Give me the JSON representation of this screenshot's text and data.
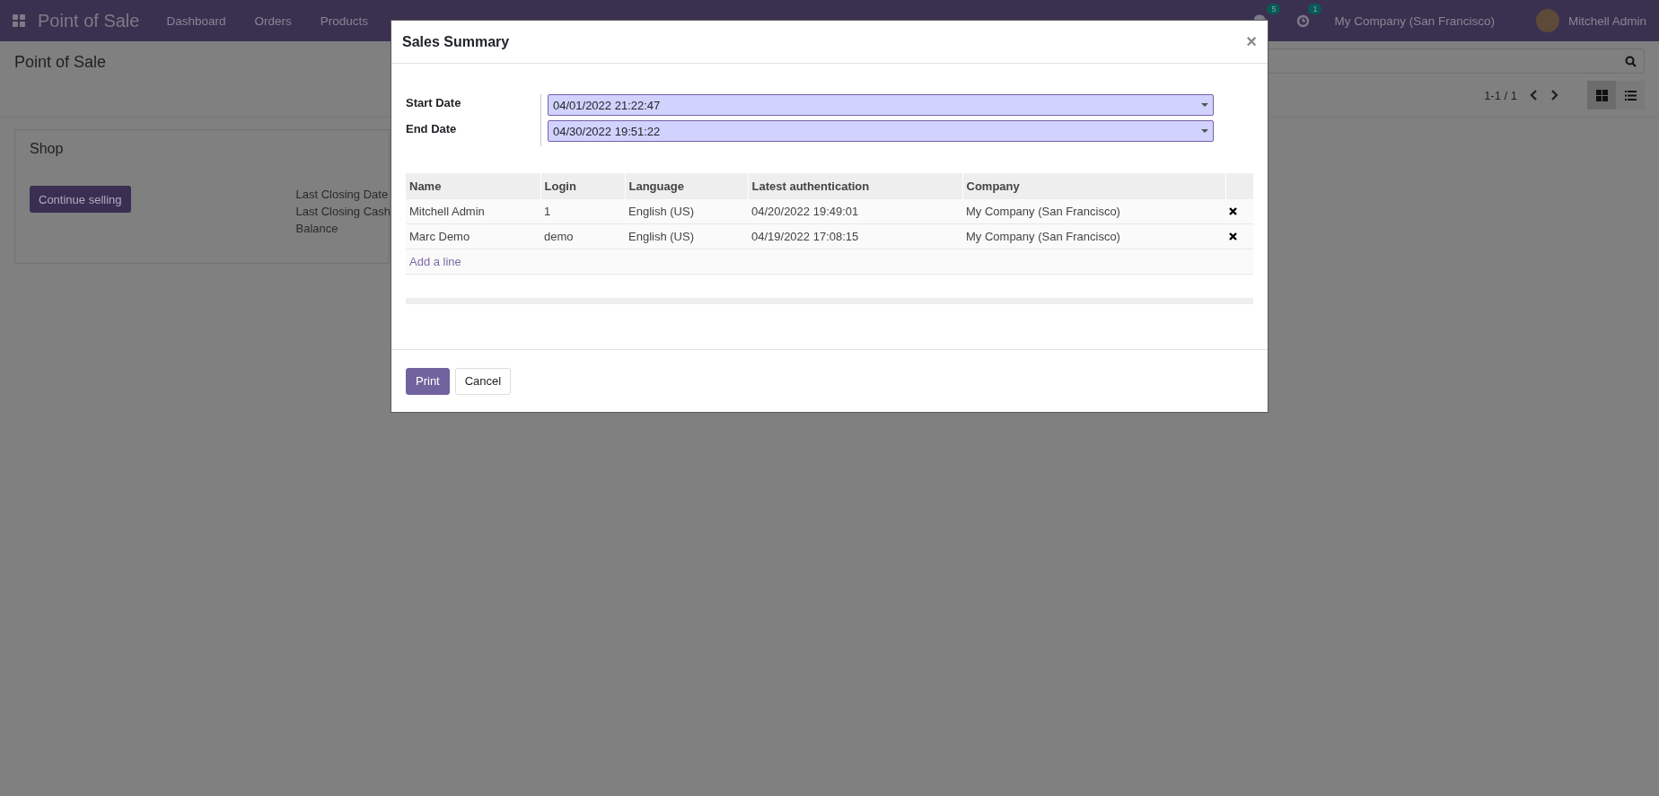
{
  "navbar": {
    "app_title": "Point of Sale",
    "menu": [
      "Dashboard",
      "Orders",
      "Products"
    ],
    "messages_badge": "5",
    "activities_badge": "1",
    "company": "My Company (San Francisco)",
    "user": "Mitchell Admin"
  },
  "control_panel": {
    "breadcrumb": "Point of Sale",
    "pager": "1-1 / 1",
    "views": [
      {
        "kind": "kanban",
        "selected": true
      },
      {
        "kind": "list",
        "selected": false
      }
    ]
  },
  "card": {
    "title": "Shop",
    "button": "Continue selling",
    "labels": [
      "Last Closing Date",
      "Last Closing Cash",
      "Balance"
    ]
  },
  "dialog": {
    "title": "Sales Summary",
    "close": "×",
    "fields": [
      {
        "label": "Start Date",
        "value": "04/01/2022 21:22:47"
      },
      {
        "label": "End Date",
        "value": "04/30/2022 19:51:22"
      }
    ],
    "table": {
      "columns": [
        "Name",
        "Login",
        "Language",
        "Latest authentication",
        "Company"
      ],
      "rows": [
        {
          "cells": [
            "Mitchell Admin",
            "1",
            "English (US)",
            "04/20/2022 19:49:01",
            "My Company (San Francisco)"
          ]
        },
        {
          "cells": [
            "Marc Demo",
            "demo",
            "English (US)",
            "04/19/2022 17:08:15",
            "My Company (San Francisco)"
          ]
        }
      ],
      "add_line": "Add a line"
    },
    "buttons": [
      {
        "label": "Print",
        "kind": "primary"
      },
      {
        "label": "Cancel",
        "kind": "secondary"
      }
    ]
  }
}
